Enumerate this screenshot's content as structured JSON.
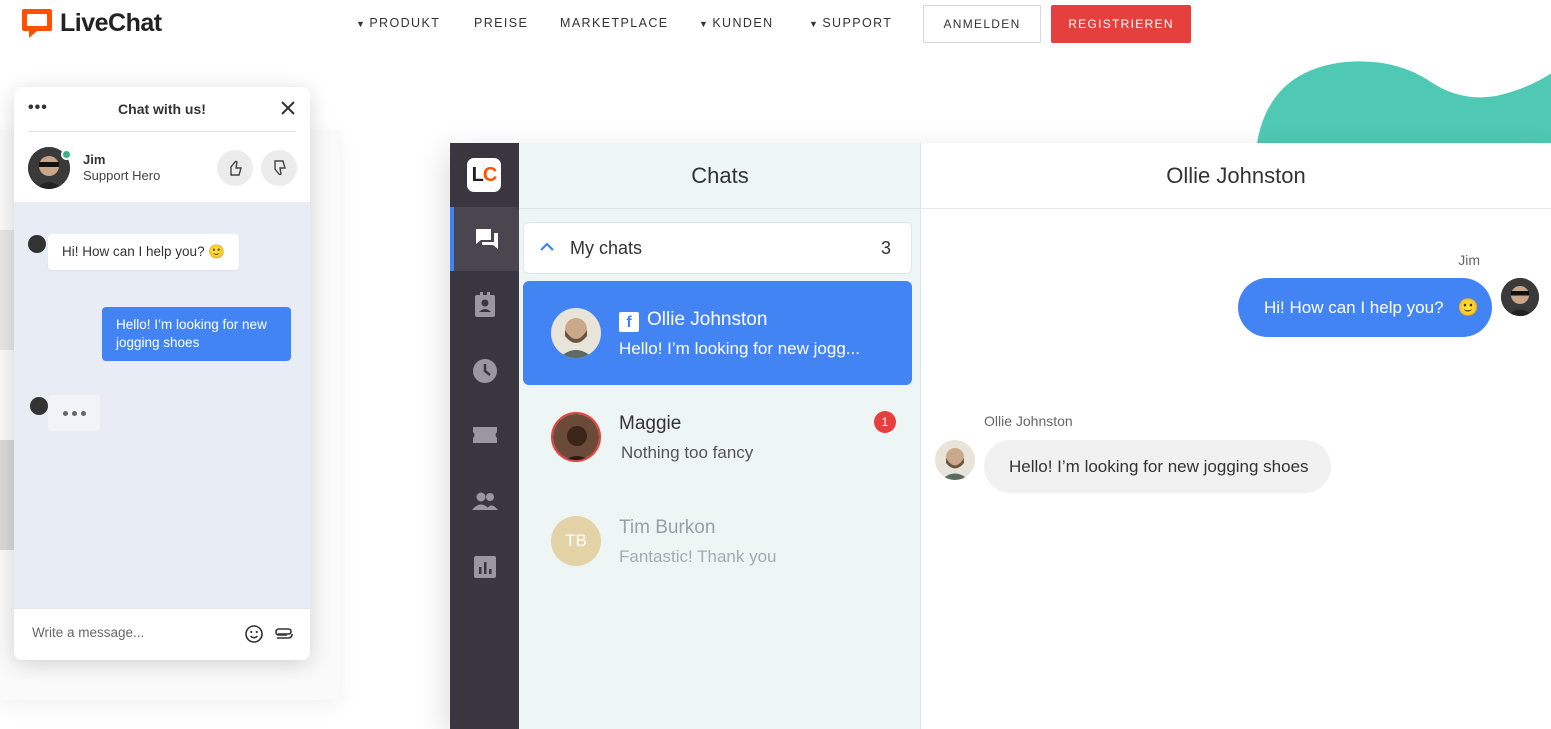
{
  "brand": {
    "name": "LiveChat",
    "accent": "#ff5100"
  },
  "nav": {
    "items": [
      {
        "label": "PRODUKT",
        "caret": true
      },
      {
        "label": "PREISE",
        "caret": false
      },
      {
        "label": "MARKETPLACE",
        "caret": false
      },
      {
        "label": "KUNDEN",
        "caret": true
      },
      {
        "label": "SUPPORT",
        "caret": true
      }
    ],
    "login_label": "ANMELDEN",
    "register_label": "REGISTRIEREN"
  },
  "widget": {
    "title": "Chat with us!",
    "agent": {
      "name": "Jim",
      "role": "Support Hero"
    },
    "messages": [
      {
        "from": "agent",
        "text": "Hi! How can I help you?"
      },
      {
        "from": "customer",
        "text": "Hello! I’m looking for new jogging shoes"
      }
    ],
    "input_placeholder": "Write a message..."
  },
  "app": {
    "logo_text": "LC",
    "sidebar_icons": [
      "chats-icon",
      "customers-icon",
      "archives-icon",
      "tickets-icon",
      "agents-icon",
      "reports-icon"
    ],
    "chats_title": "Chats",
    "my_chats": {
      "label": "My chats",
      "count": "3"
    },
    "chats": [
      {
        "name": "Ollie Johnston",
        "message": "Hello! I’m looking for new jogg...",
        "source": "facebook",
        "active": true
      },
      {
        "name": "Maggie",
        "message": "Nothing too fancy",
        "badge": "1"
      },
      {
        "name": "Tim Burkon",
        "message": "Fantastic! Thank you",
        "initials": "TB"
      }
    ],
    "conversation": {
      "title": "Ollie Johnston",
      "agent_name": "Jim",
      "agent_message": "Hi! How can I help you?",
      "customer_name": "Ollie Johnston",
      "customer_message": "Hello! I’m looking for new jogging shoes"
    }
  },
  "colors": {
    "primary_blue": "#4384f5",
    "register_red": "#e5403d",
    "teal": "#4fc9b4",
    "sidebar_dark": "#39363f"
  }
}
